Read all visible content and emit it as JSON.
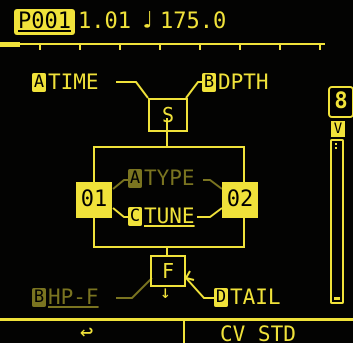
{
  "colors": {
    "fg": "#f0e23a",
    "dim": "#7a7420",
    "background": "#030302"
  },
  "header": {
    "patch_id": "P001",
    "bar_position": "1.01",
    "note_icon": "quarter-note-icon",
    "note_glyph": "♩",
    "tempo": "175.0"
  },
  "params": {
    "time": {
      "knob": "A",
      "label": "TIME"
    },
    "depth": {
      "knob": "B",
      "label": "DPTH"
    },
    "type": {
      "knob": "A",
      "label": "TYPE"
    },
    "tune": {
      "knob": "C",
      "label": "TUNE"
    },
    "hpf": {
      "knob": "B",
      "label": "HP-F"
    },
    "tail": {
      "knob": "D",
      "label": "TAIL"
    }
  },
  "routing": {
    "source_box": "S",
    "filter_box": "F",
    "osc1": "01",
    "osc2": "02",
    "output_arrow_glyph": "↓"
  },
  "side_panel": {
    "channel_number": "8",
    "meter_label": "V",
    "meter_level": 0.02
  },
  "footer": {
    "left_icon": "return-arrow-icon",
    "left_glyph": "↩",
    "right_label": "CV STD"
  }
}
